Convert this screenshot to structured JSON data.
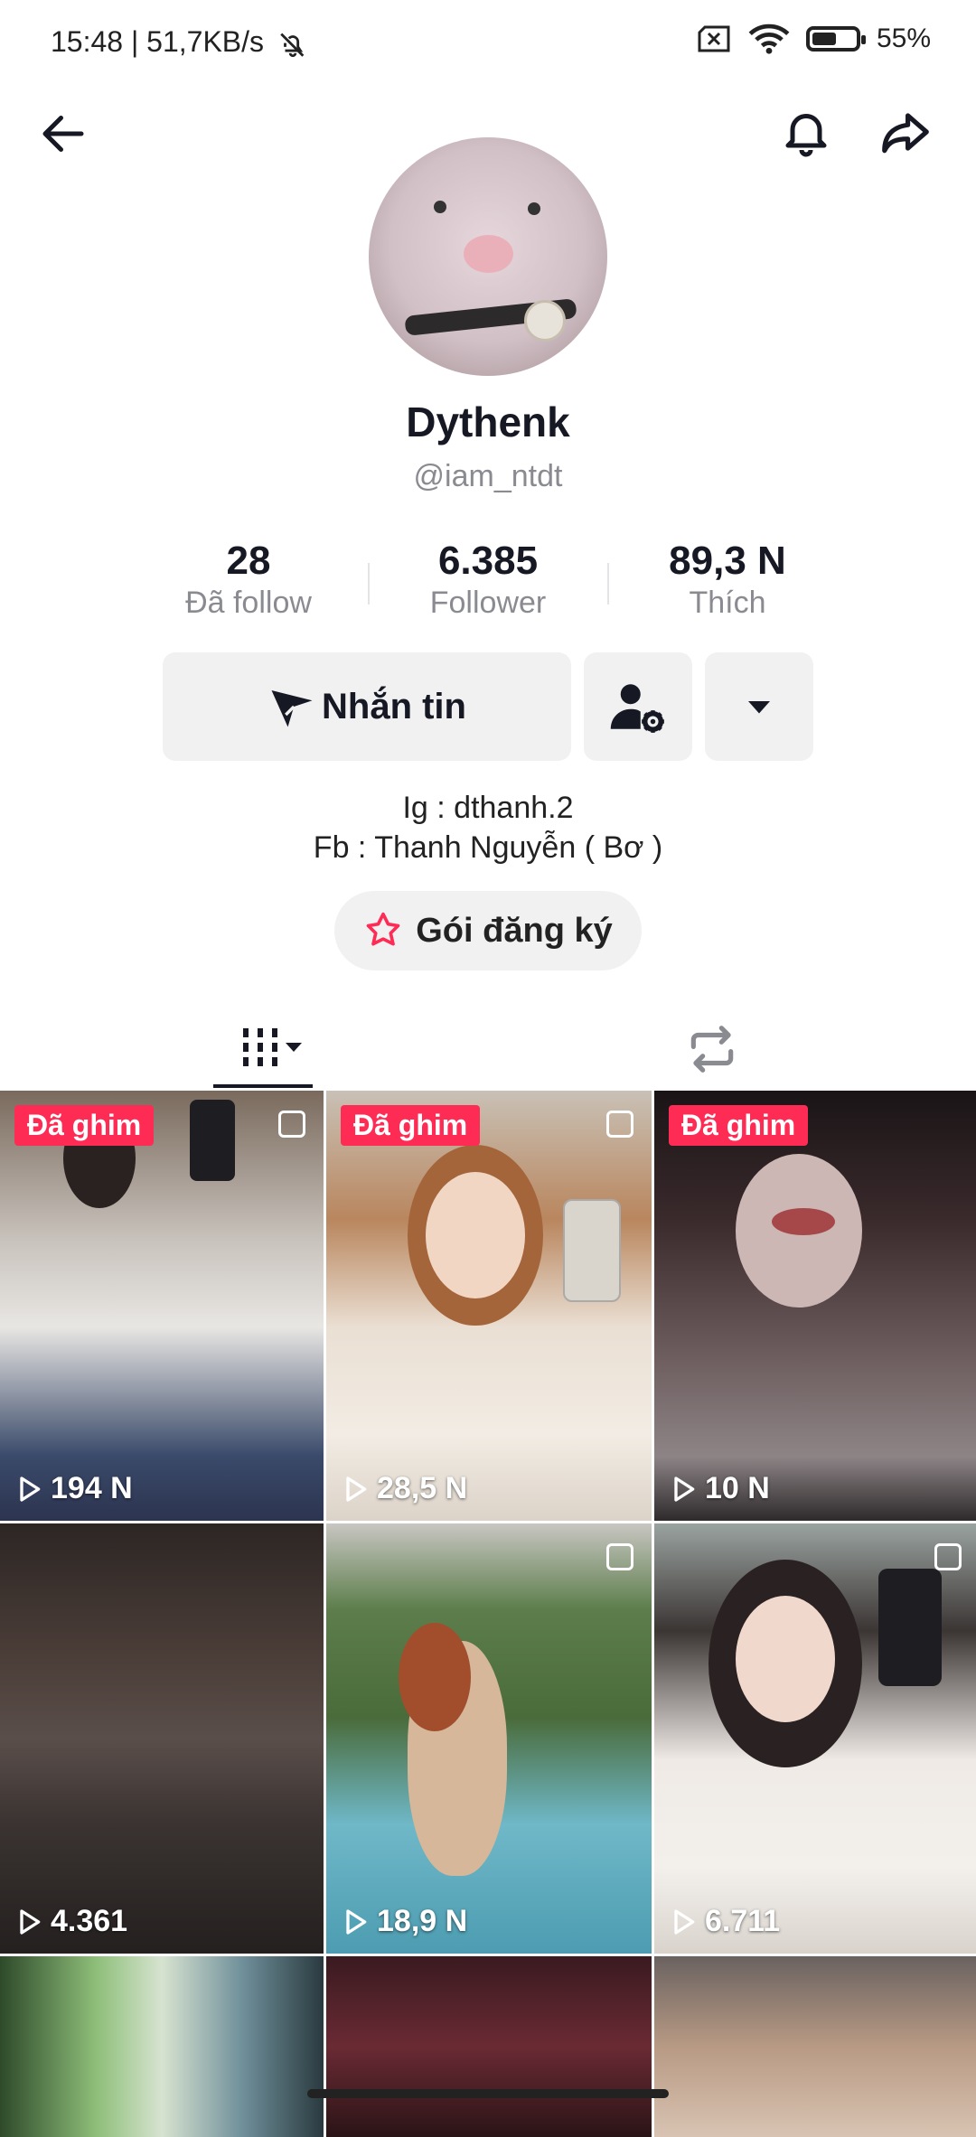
{
  "status": {
    "time_speed": "15:48 | 51,7KB/s",
    "battery": "55%",
    "battery_level": 0.55
  },
  "profile": {
    "display_name": "Dythenk",
    "handle": "@iam_ntdt",
    "stats": [
      {
        "value": "28",
        "label": "Đã follow"
      },
      {
        "value": "6.385",
        "label": "Follower"
      },
      {
        "value": "89,3 N",
        "label": "Thích"
      }
    ],
    "message_button": "Nhắn tin",
    "bio_lines": [
      "Ig : dthanh.2",
      "Fb : Thanh Nguyễn ( Bơ )"
    ],
    "subscription_button": "Gói đăng ký"
  },
  "videos": [
    {
      "pinned": "Đã ghim",
      "views": "194 N"
    },
    {
      "pinned": "Đã ghim",
      "views": "28,5 N"
    },
    {
      "pinned": "Đã ghim",
      "views": "10 N"
    },
    {
      "views": "4.361"
    },
    {
      "views": "18,9 N"
    },
    {
      "views": "6.711"
    },
    {},
    {},
    {}
  ],
  "colors": {
    "accent": "#fe2c55",
    "text": "#161823",
    "muted": "#8a8b91",
    "button_bg": "#f1f1f2"
  },
  "icons": [
    "back-arrow-icon",
    "bell-icon",
    "share-icon",
    "send-icon",
    "person-settings-icon",
    "caret-down-icon",
    "grid-icon",
    "repost-icon",
    "play-icon"
  ]
}
